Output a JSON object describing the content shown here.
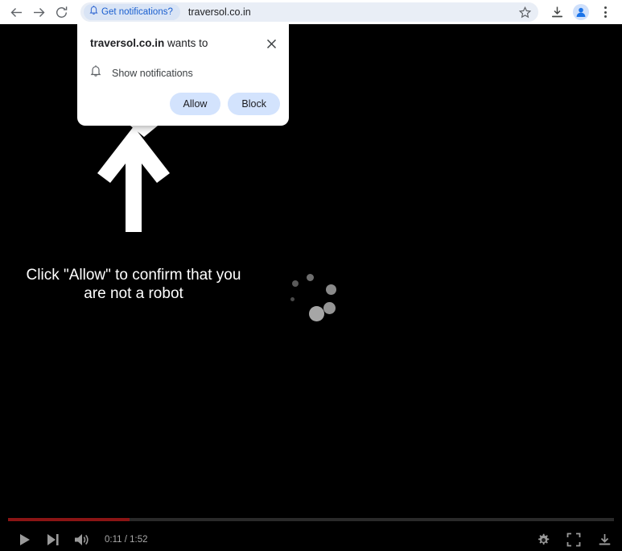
{
  "browser": {
    "back_icon": "arrow-left-icon",
    "forward_icon": "arrow-right-icon",
    "reload_icon": "reload-icon",
    "omnibox": {
      "notification_chip_label": "Get notifications?",
      "notification_chip_icon": "bell-icon",
      "url": "traversol.co.in",
      "bookmark_icon": "star-icon"
    },
    "downloads_icon": "download-icon",
    "profile_icon": "profile-avatar-icon",
    "menu_icon": "kebab-menu-icon",
    "chip_text_color": "#1a5fd0",
    "omnibox_bg": "#e9eef6"
  },
  "permission_dialog": {
    "origin": "traversol.co.in",
    "title_suffix": " wants to",
    "close_icon": "close-icon",
    "permission_icon": "bell-icon",
    "permission_label": "Show notifications",
    "allow_label": "Allow",
    "block_label": "Block",
    "button_bg": "#d3e3fd"
  },
  "page": {
    "arrow_icon": "up-arrow-icon",
    "cta_line1": "Click \"Allow\" to confirm that you",
    "cta_line2": "are not a robot",
    "spinner_icon": "loading-spinner-icon",
    "background": "#000000"
  },
  "player": {
    "play_icon": "play-icon",
    "next_icon": "next-track-icon",
    "volume_icon": "volume-icon",
    "time_display": "0:11 / 1:52",
    "current_time": "0:11",
    "duration": "1:52",
    "progress_percent": 20,
    "progress_color": "#8b1414",
    "settings_icon": "gear-icon",
    "fullscreen_icon": "fullscreen-icon",
    "download_icon": "download-icon"
  }
}
